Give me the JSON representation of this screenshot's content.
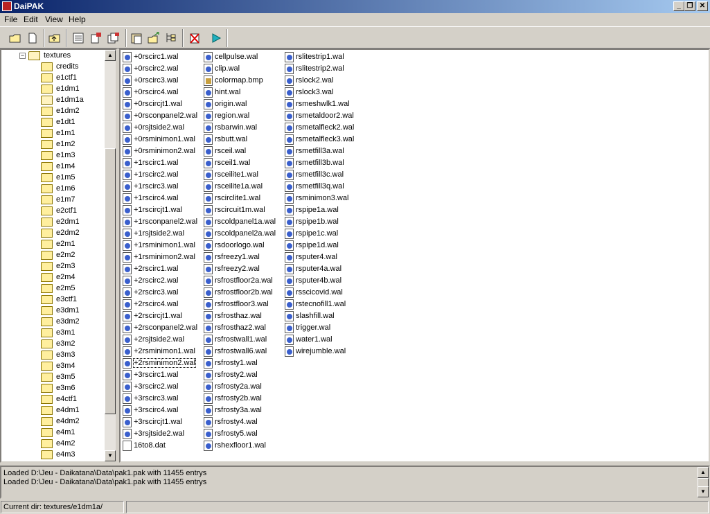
{
  "window": {
    "title": "DaiPAK"
  },
  "menu": [
    "File",
    "Edit",
    "View",
    "Help"
  ],
  "toolbar": {
    "buttons": [
      "open-icon",
      "new-icon",
      "up-folder-icon",
      "properties-icon",
      "extract-icon",
      "extract-all-icon",
      "paste-icon",
      "export-icon",
      "tree-icon",
      "delete-icon",
      "run-icon"
    ]
  },
  "tree": {
    "root": "textures",
    "folders": [
      "credits",
      "e1ctf1",
      "e1dm1",
      "e1dm1a",
      "e1dm2",
      "e1dt1",
      "e1m1",
      "e1m2",
      "e1m3",
      "e1m4",
      "e1m5",
      "e1m6",
      "e1m7",
      "e2ctf1",
      "e2dm1",
      "e2dm2",
      "e2m1",
      "e2m2",
      "e2m3",
      "e2m4",
      "e2m5",
      "e3ctf1",
      "e3dm1",
      "e3dm2",
      "e3m1",
      "e3m2",
      "e3m3",
      "e3m4",
      "e3m5",
      "e3m6",
      "e4ctf1",
      "e4dm1",
      "e4dm2",
      "e4m1",
      "e4m2",
      "e4m3"
    ],
    "open_folder": "e1dm1a"
  },
  "files": {
    "col1": [
      "+0rscirc1.wal",
      "+0rscirc2.wal",
      "+0rscirc3.wal",
      "+0rscirc4.wal",
      "+0rscircjt1.wal",
      "+0rsconpanel2.wal",
      "+0rsjtside2.wal",
      "+0rsminimon1.wal",
      "+0rsminimon2.wal",
      "+1rscirc1.wal",
      "+1rscirc2.wal",
      "+1rscirc3.wal",
      "+1rscirc4.wal",
      "+1rscircjt1.wal",
      "+1rsconpanel2.wal",
      "+1rsjtside2.wal",
      "+1rsminimon1.wal",
      "+1rsminimon2.wal",
      "+2rscirc1.wal",
      "+2rscirc2.wal",
      "+2rscirc3.wal",
      "+2rscirc4.wal",
      "+2rscircjt1.wal",
      "+2rsconpanel2.wal",
      "+2rsjtside2.wal",
      "+2rsminimon1.wal",
      "+2rsminimon2.wal",
      "+3rscirc1.wal",
      "+3rscirc2.wal",
      "+3rscirc3.wal",
      "+3rscirc4.wal",
      "+3rscircjt1.wal",
      "+3rsjtside2.wal",
      "16to8.dat"
    ],
    "col2": [
      "cellpulse.wal",
      "clip.wal",
      "colormap.bmp",
      "hint.wal",
      "origin.wal",
      "region.wal",
      "rsbarwin.wal",
      "rsbutt.wal",
      "rsceil.wal",
      "rsceil1.wal",
      "rsceilite1.wal",
      "rsceilite1a.wal",
      "rscirclite1.wal",
      "rscircuit1m.wal",
      "rscoldpanel1a.wal",
      "rscoldpanel2a.wal",
      "rsdoorlogo.wal",
      "rsfreezy1.wal",
      "rsfreezy2.wal",
      "rsfrostfloor2a.wal",
      "rsfrostfloor2b.wal",
      "rsfrostfloor3.wal",
      "rsfrosthaz.wal",
      "rsfrosthaz2.wal",
      "rsfrostwall1.wal",
      "rsfrostwall6.wal",
      "rsfrosty1.wal",
      "rsfrosty2.wal",
      "rsfrosty2a.wal",
      "rsfrosty2b.wal",
      "rsfrosty3a.wal",
      "rsfrosty4.wal",
      "rsfrosty5.wal",
      "rshexfloor1.wal"
    ],
    "col3": [
      "rslitestrip1.wal",
      "rslitestrip2.wal",
      "rslock2.wal",
      "rslock3.wal",
      "rsmeshwlk1.wal",
      "rsmetaldoor2.wal",
      "rsmetalfleck2.wal",
      "rsmetalfleck3.wal",
      "rsmetfill3a.wal",
      "rsmetfill3b.wal",
      "rsmetfill3c.wal",
      "rsmetfill3q.wal",
      "rsminimon3.wal",
      "rspipe1a.wal",
      "rspipe1b.wal",
      "rspipe1c.wal",
      "rspipe1d.wal",
      "rsputer4.wal",
      "rsputer4a.wal",
      "rsputer4b.wal",
      "rsscicovid.wal",
      "rstecnofill1.wal",
      "slashfill.wal",
      "trigger.wal",
      "water1.wal",
      "wirejumble.wal"
    ],
    "selected": "+2rsminimon2.wal"
  },
  "log": [
    "Loaded D:\\Jeu - Daikatana\\Data\\pak1.pak with 11455 entrys",
    "Loaded D:\\Jeu - Daikatana\\Data\\pak1.pak with 11455 entrys"
  ],
  "status": {
    "current_dir": "Current dir: textures/e1dm1a/"
  }
}
